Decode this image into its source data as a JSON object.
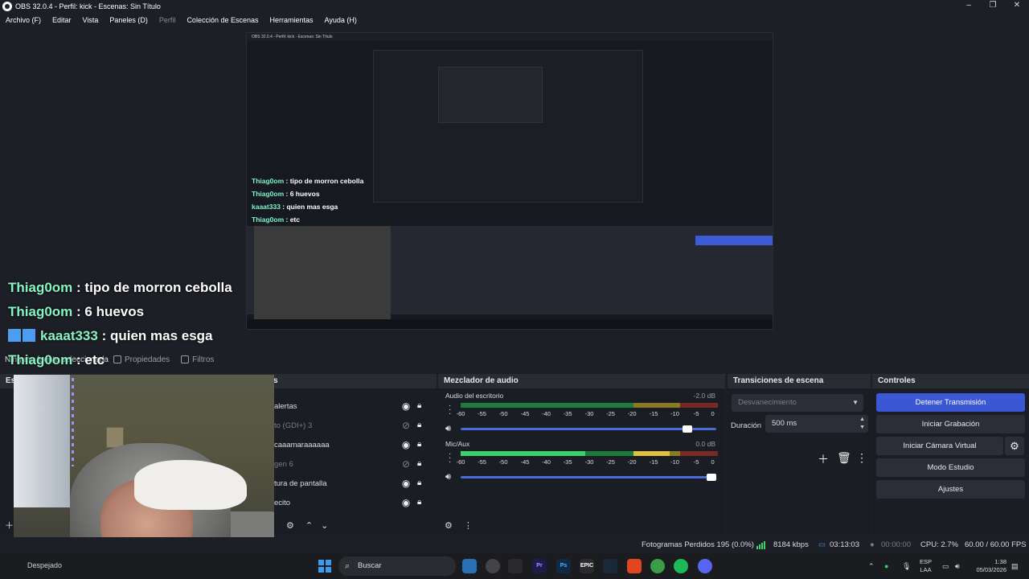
{
  "window": {
    "title": "OBS 32.0.4 - Perfil: kick - Escenas: Sin Título",
    "controls": [
      "–",
      "❐",
      "✕"
    ]
  },
  "menu": {
    "items": [
      "Archivo (F)",
      "Editar",
      "Vista",
      "Paneles (D)",
      "Perfil",
      "Colección de Escenas",
      "Herramientas",
      "Ayuda (H)"
    ]
  },
  "preview": {
    "nested_title": "OBS 32.0.4 - Perfil: kick - Escenas: Sin Título",
    "nested_chat": [
      {
        "nick": "Thiag0om",
        "text": " : tipo de morron cebolla"
      },
      {
        "nick": "Thiag0om",
        "text": " : 6 huevos"
      },
      {
        "nick": "kaaat333",
        "text": " : quien mas esga"
      },
      {
        "nick": "Thiag0om",
        "text": " : etc"
      }
    ]
  },
  "chat": [
    {
      "nick": "Thiag0om",
      "text": " : tipo de morron cebolla",
      "badge": false
    },
    {
      "nick": "Thiag0om",
      "text": " : 6 huevos",
      "badge": false
    },
    {
      "nick": "kaaat333",
      "text": " : quien mas esga",
      "badge": true
    },
    {
      "nick": "Thiag0om",
      "text": " : etc",
      "badge": false
    }
  ],
  "scene_toolbar": {
    "no_selection": "Ninguna fuente seleccionada",
    "properties": "Propiedades",
    "filters": "Filtros"
  },
  "docks": {
    "scenes_title": "Esc",
    "sources_title": "s",
    "mixer_title": "Mezclador de audio",
    "transitions_title": "Transiciones de escena",
    "controls_title": "Controles"
  },
  "sources": [
    {
      "label": "alertas",
      "visible": true,
      "dim": false
    },
    {
      "label": "to (GDI+) 3",
      "visible": false,
      "dim": true
    },
    {
      "label": "caaamaraaaaaa",
      "visible": true,
      "dim": false
    },
    {
      "label": "gen 6",
      "visible": false,
      "dim": true
    },
    {
      "label": "tura de pantalla",
      "visible": true,
      "dim": false
    },
    {
      "label": "ecito",
      "visible": true,
      "dim": false
    }
  ],
  "mixer": {
    "channels": [
      {
        "name": "Audio del escritorio",
        "db": "-2.0 dB",
        "volume_fraction": 0.9
      },
      {
        "name": "Mic/Aux",
        "db": "0.0 dB",
        "volume_fraction": 1.0
      }
    ],
    "ticks": [
      "-60",
      "-55",
      "-50",
      "-45",
      "-40",
      "-35",
      "-30",
      "-25",
      "-20",
      "-15",
      "-10",
      "-5",
      "0"
    ]
  },
  "transitions": {
    "selected": "Desvanecimiento",
    "duration_label": "Duración",
    "duration_value": "500 ms"
  },
  "controls": {
    "stop_stream": "Detener Transmisión",
    "start_record": "Iniciar Grabación",
    "start_virtualcam": "Iniciar Cámara Virtual",
    "studio_mode": "Modo Estudio",
    "settings": "Ajustes"
  },
  "status": {
    "dropped_frames": "Fotogramas Perdidos 195 (0.0%)",
    "bitrate": "8184 kbps",
    "stream_time": "03:13:03",
    "record_time": "00:00:00",
    "cpu": "CPU: 2.7%",
    "fps": "60.00 / 60.00 FPS"
  },
  "taskbar": {
    "weather": "Despejado",
    "search_placeholder": "Buscar",
    "lang_top": "ESP",
    "lang_bottom": "LAA",
    "time": "1:38",
    "date": "05/03/2026"
  },
  "colors": {
    "accent": "#3c57d4",
    "meter_green": "#3ad26b",
    "meter_yellow": "#e2c23c",
    "meter_red": "#d4483c",
    "chat_nick": "#86f5c4"
  }
}
